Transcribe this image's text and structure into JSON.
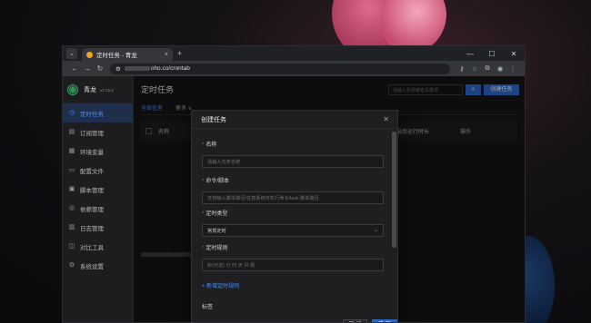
{
  "browser": {
    "tab_title": "定时任务 - 青龙",
    "url_visible": "oho.co/crontab",
    "window_controls": [
      "—",
      "☐",
      "✕"
    ]
  },
  "sidebar": {
    "brand": "青龙",
    "version": "v2.19.2",
    "items": [
      {
        "label": "定时任务",
        "icon": "clock-icon",
        "active": true
      },
      {
        "label": "订阅管理",
        "icon": "subscription-icon"
      },
      {
        "label": "环境变量",
        "icon": "variable-icon"
      },
      {
        "label": "配置文件",
        "icon": "config-icon"
      },
      {
        "label": "脚本管理",
        "icon": "script-icon"
      },
      {
        "label": "依赖管理",
        "icon": "dependency-icon"
      },
      {
        "label": "日志管理",
        "icon": "log-icon"
      },
      {
        "label": "对比工具",
        "icon": "diff-icon"
      },
      {
        "label": "系统设置",
        "icon": "settings-icon"
      }
    ]
  },
  "main": {
    "title": "定时任务",
    "search_placeholder": "请输入名称或者关键词",
    "create_label": "创建任务",
    "tabs": [
      "全部任务",
      "更多 ∨"
    ],
    "columns": [
      "名称",
      "最后运行时长",
      "操作"
    ]
  },
  "modal": {
    "title": "创建任务",
    "fields": [
      {
        "label": "名称",
        "placeholder": "请输入任务名称",
        "required": true
      },
      {
        "label": "命令/脚本",
        "placeholder": "支持输入脚本路径/任意系统可执行命令/task 脚本路径",
        "required": true
      },
      {
        "label": "定时类型",
        "value": "常规定时",
        "required": true
      },
      {
        "label": "定时规则",
        "placeholder": "秒(可选) 分 时 天 月 周",
        "required": true
      }
    ],
    "add_rule_label": "+ 新增定时规则",
    "tags_label": "标签",
    "cancel_label": "取 消",
    "ok_label": "确 定"
  }
}
